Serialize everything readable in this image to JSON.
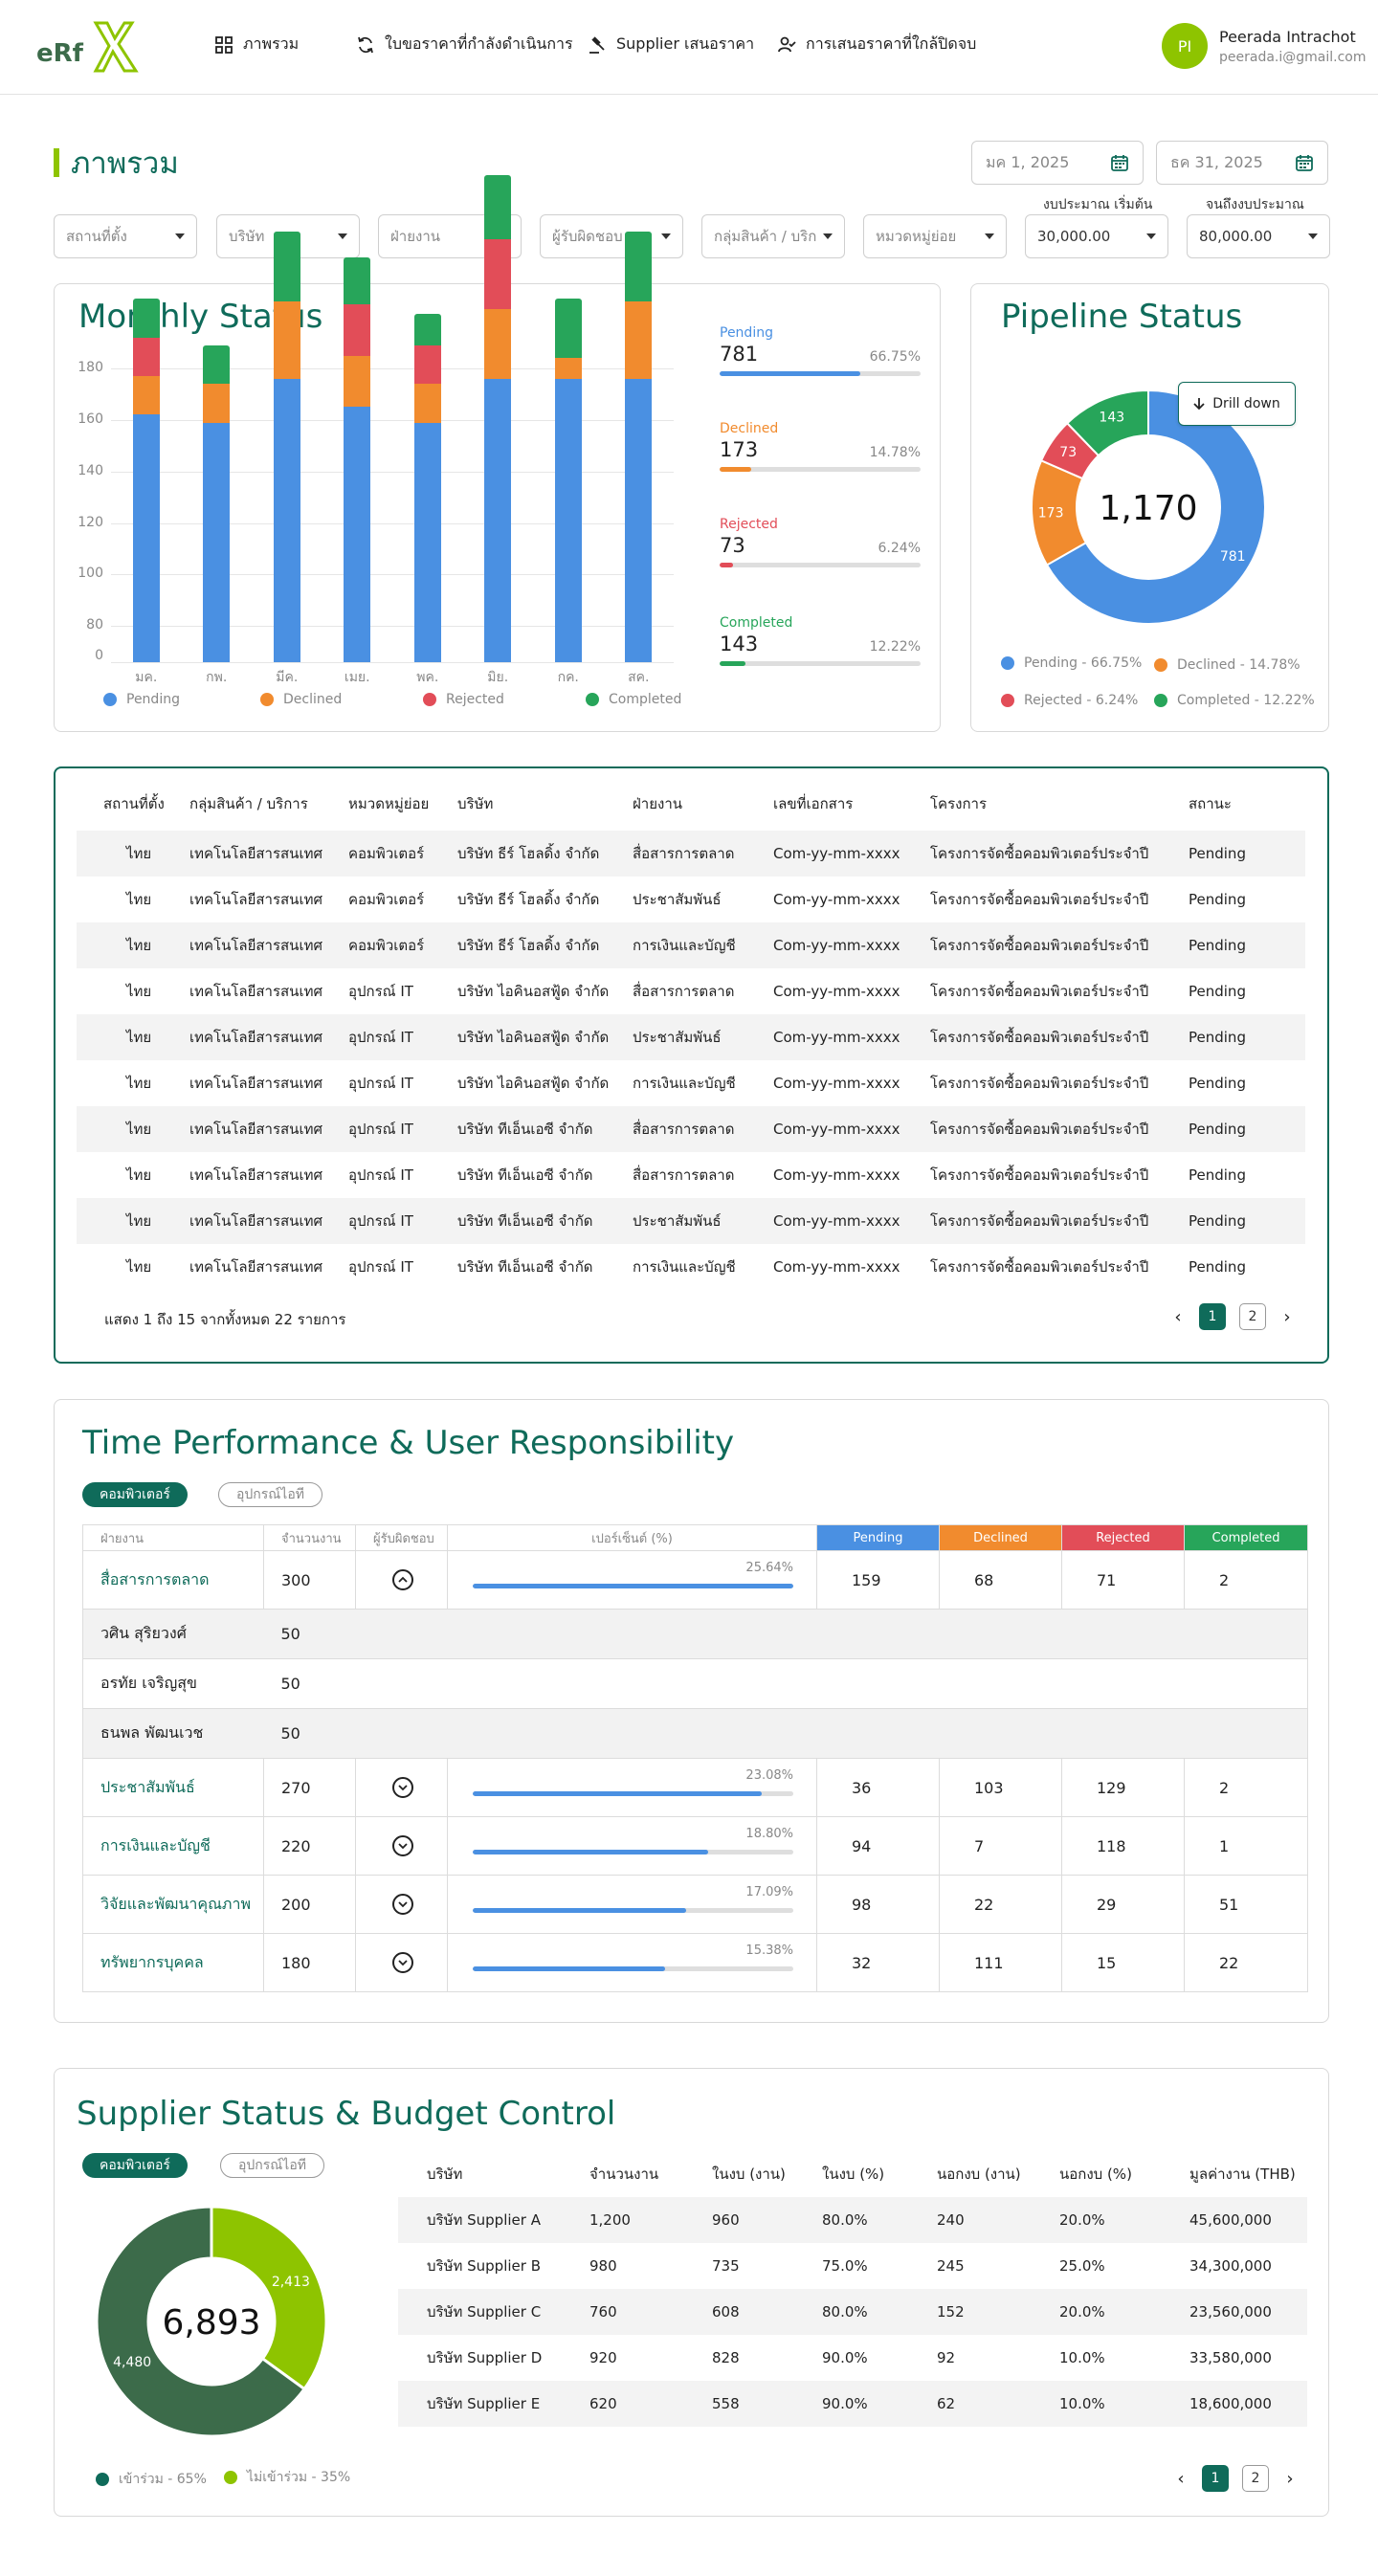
{
  "header": {
    "nav": [
      {
        "label": "ภาพรวม",
        "icon": "grid-icon"
      },
      {
        "label": "ใบขอราคาที่กำลังดำเนินการ",
        "icon": "refresh-icon"
      },
      {
        "label": "Supplier เสนอราคา",
        "icon": "gavel-icon"
      },
      {
        "label": "การเสนอราคาที่ใกล้ปิดจบ",
        "icon": "user-check-icon"
      }
    ],
    "user": {
      "initials": "PI",
      "name": "Peerada Intrachot",
      "email": "peerada.i@gmail.com"
    }
  },
  "page_title": "ภาพรวม",
  "dates": {
    "start": "มค 1, 2025",
    "end": "ธค 31, 2025"
  },
  "filters": [
    {
      "placeholder": "สถานที่ตั้ง"
    },
    {
      "placeholder": "บริษัท"
    },
    {
      "placeholder": "ฝ่ายงาน"
    },
    {
      "placeholder": "ผู้รับผิดชอบ"
    },
    {
      "placeholder": "กลุ่มสินค้า / บริการ"
    },
    {
      "placeholder": "หมวดหมู่ย่อย"
    }
  ],
  "budget": {
    "start_label": "งบประมาณ เริ่มต้น",
    "start_value": "30,000.00",
    "end_label": "จนถึงงบประมาณ",
    "end_value": "80,000.00"
  },
  "monthly": {
    "title": "Monthly Status",
    "stats": [
      {
        "label": "Pending",
        "value": "781",
        "pct": "66.75%",
        "fraction": 0.6675
      },
      {
        "label": "Declined",
        "value": "173",
        "pct": "14.78%",
        "fraction": 0.1478
      },
      {
        "label": "Rejected",
        "value": "73",
        "pct": "6.24%",
        "fraction": 0.0624
      },
      {
        "label": "Completed",
        "value": "143",
        "pct": "12.22%",
        "fraction": 0.1222
      }
    ]
  },
  "chart_data": [
    {
      "type": "bar",
      "stacked": true,
      "categories": [
        "มค.",
        "กพ.",
        "มีค.",
        "เมย.",
        "พค.",
        "มิย.",
        "กค.",
        "สค."
      ],
      "series": [
        {
          "name": "Pending",
          "color": "#4a90e2",
          "values": [
            96,
            93,
            110,
            99,
            93,
            110,
            110,
            110
          ]
        },
        {
          "name": "Declined",
          "color": "#f18b2e",
          "values": [
            15,
            15,
            30,
            20,
            15,
            27,
            8,
            30
          ]
        },
        {
          "name": "Rejected",
          "color": "#e24d58",
          "values": [
            15,
            0,
            0,
            20,
            15,
            27,
            0,
            0
          ]
        },
        {
          "name": "Completed",
          "color": "#27a55a",
          "values": [
            15,
            15,
            27,
            18,
            12,
            25,
            23,
            27
          ]
        }
      ],
      "yticks": [
        0,
        80,
        100,
        120,
        140,
        160,
        180
      ],
      "ylim": [
        66,
        180
      ],
      "grid": true,
      "legend": "bottom"
    },
    {
      "type": "pie",
      "title": "Pipeline Status",
      "donut": true,
      "center_label": "1,170",
      "labels": [
        "Pending",
        "Declined",
        "Rejected",
        "Completed"
      ],
      "values": [
        781,
        173,
        73,
        143
      ],
      "colors": [
        "#4a90e2",
        "#f18b2e",
        "#e24d58",
        "#27a55a"
      ],
      "legend": [
        "Pending - 66.75%",
        "Declined - 14.78%",
        "Rejected  - 6.24%",
        "Completed - 12.22%"
      ]
    },
    {
      "type": "pie",
      "donut": true,
      "center_label": "6,893",
      "labels": [
        "เข้าร่วม",
        "ไม่เข้าร่วม"
      ],
      "values": [
        4480,
        2413
      ],
      "value_labels": [
        "4,480",
        "2,413"
      ],
      "colors": [
        "#3c6b4a",
        "#8ec400"
      ],
      "legend": [
        "เข้าร่วม - 65%",
        "ไม่เข้าร่วม - 35%"
      ]
    }
  ],
  "pipeline": {
    "drill": "Drill down"
  },
  "main_table": {
    "columns": [
      "สถานที่ตั้ง",
      "กลุ่มสินค้า / บริการ",
      "หมวดหมู่ย่อย",
      "บริษัท",
      "ฝ่ายงาน",
      "เลขที่เอกสาร",
      "โครงการ",
      "สถานะ"
    ],
    "rows": [
      [
        "ไทย",
        "เทคโนโลยีสารสนเทศ",
        "คอมพิวเตอร์",
        "บริษัท ธีร์ โฮลดิ้ง จำกัด",
        "สื่อสารการตลาด",
        "Com-yy-mm-xxxx",
        "โครงการจัดซื้อคอมพิวเตอร์ประจำปี",
        "Pending"
      ],
      [
        "ไทย",
        "เทคโนโลยีสารสนเทศ",
        "คอมพิวเตอร์",
        "บริษัท ธีร์ โฮลดิ้ง จำกัด",
        "ประชาสัมพันธ์",
        "Com-yy-mm-xxxx",
        "โครงการจัดซื้อคอมพิวเตอร์ประจำปี",
        "Pending"
      ],
      [
        "ไทย",
        "เทคโนโลยีสารสนเทศ",
        "คอมพิวเตอร์",
        "บริษัท ธีร์ โฮลดิ้ง จำกัด",
        "การเงินและบัญชี",
        "Com-yy-mm-xxxx",
        "โครงการจัดซื้อคอมพิวเตอร์ประจำปี",
        "Pending"
      ],
      [
        "ไทย",
        "เทคโนโลยีสารสนเทศ",
        "อุปกรณ์ IT",
        "บริษัท ไอคินอสฟู้ด จำกัด",
        "สื่อสารการตลาด",
        "Com-yy-mm-xxxx",
        "โครงการจัดซื้อคอมพิวเตอร์ประจำปี",
        "Pending"
      ],
      [
        "ไทย",
        "เทคโนโลยีสารสนเทศ",
        "อุปกรณ์ IT",
        "บริษัท ไอคินอสฟู้ด จำกัด",
        "ประชาสัมพันธ์",
        "Com-yy-mm-xxxx",
        "โครงการจัดซื้อคอมพิวเตอร์ประจำปี",
        "Pending"
      ],
      [
        "ไทย",
        "เทคโนโลยีสารสนเทศ",
        "อุปกรณ์ IT",
        "บริษัท ไอคินอสฟู้ด จำกัด",
        "การเงินและบัญชี",
        "Com-yy-mm-xxxx",
        "โครงการจัดซื้อคอมพิวเตอร์ประจำปี",
        "Pending"
      ],
      [
        "ไทย",
        "เทคโนโลยีสารสนเทศ",
        "อุปกรณ์ IT",
        "บริษัท ทีเอ็นเอซี จำกัด",
        "สื่อสารการตลาด",
        "Com-yy-mm-xxxx",
        "โครงการจัดซื้อคอมพิวเตอร์ประจำปี",
        "Pending"
      ],
      [
        "ไทย",
        "เทคโนโลยีสารสนเทศ",
        "อุปกรณ์ IT",
        "บริษัท ทีเอ็นเอซี จำกัด",
        "สื่อสารการตลาด",
        "Com-yy-mm-xxxx",
        "โครงการจัดซื้อคอมพิวเตอร์ประจำปี",
        "Pending"
      ],
      [
        "ไทย",
        "เทคโนโลยีสารสนเทศ",
        "อุปกรณ์ IT",
        "บริษัท ทีเอ็นเอซี จำกัด",
        "ประชาสัมพันธ์",
        "Com-yy-mm-xxxx",
        "โครงการจัดซื้อคอมพิวเตอร์ประจำปี",
        "Pending"
      ],
      [
        "ไทย",
        "เทคโนโลยีสารสนเทศ",
        "อุปกรณ์ IT",
        "บริษัท ทีเอ็นเอซี จำกัด",
        "การเงินและบัญชี",
        "Com-yy-mm-xxxx",
        "โครงการจัดซื้อคอมพิวเตอร์ประจำปี",
        "Pending"
      ]
    ],
    "summary": "แสดง 1 ถึง 15 จากทั้งหมด 22 รายการ",
    "pages": [
      "1",
      "2"
    ],
    "current_page": "1"
  },
  "time_perf": {
    "title": "Time Performance & User Responsibility",
    "tabs": [
      "คอมพิวเตอร์",
      "อุปกรณ์ไอที"
    ],
    "columns": [
      "ฝ่ายงาน",
      "จำนวนงาน",
      "ผู้รับผิดชอบ",
      "เปอร์เซ็นต์ (%)",
      "Pending",
      "Declined",
      "Rejected",
      "Completed"
    ],
    "rows": [
      {
        "dept": "สื่อสารการตลาด",
        "count": "300",
        "expanded": true,
        "pct": "25.64%",
        "fraction": 0.2564,
        "pending": "159",
        "declined": "68",
        "rejected": "71",
        "completed": "2",
        "users": [
          {
            "name": "วศิน สุริยวงศ์",
            "count": "50"
          },
          {
            "name": "อรทัย เจริญสุข",
            "count": "50"
          },
          {
            "name": "ธนพล พัฒนเวช",
            "count": "50"
          }
        ]
      },
      {
        "dept": "ประชาสัมพันธ์",
        "count": "270",
        "expanded": false,
        "pct": "23.08%",
        "fraction": 0.2308,
        "pending": "36",
        "declined": "103",
        "rejected": "129",
        "completed": "2"
      },
      {
        "dept": "การเงินและบัญชี",
        "count": "220",
        "expanded": false,
        "pct": "18.80%",
        "fraction": 0.188,
        "pending": "94",
        "declined": "7",
        "rejected": "118",
        "completed": "1"
      },
      {
        "dept": "วิจัยและพัฒนาคุณภาพ",
        "count": "200",
        "expanded": false,
        "pct": "17.09%",
        "fraction": 0.1709,
        "pending": "98",
        "declined": "22",
        "rejected": "29",
        "completed": "51"
      },
      {
        "dept": "ทรัพยากรบุคคล",
        "count": "180",
        "expanded": false,
        "pct": "15.38%",
        "fraction": 0.1538,
        "pending": "32",
        "declined": "111",
        "rejected": "15",
        "completed": "22"
      }
    ]
  },
  "supplier": {
    "title": "Supplier Status & Budget Control",
    "tabs": [
      "คอมพิวเตอร์",
      "อุปกรณ์ไอที"
    ],
    "columns": [
      "บริษัท",
      "จำนวนงาน",
      "ในงบ (งาน)",
      "ในงบ (%)",
      "นอกงบ (งาน)",
      "นอกงบ (%)",
      "มูลค่างาน (THB)"
    ],
    "rows": [
      [
        "บริษัท Supplier A",
        "1,200",
        "960",
        "80.0%",
        "240",
        "20.0%",
        "45,600,000"
      ],
      [
        "บริษัท Supplier B",
        "980",
        "735",
        "75.0%",
        "245",
        "25.0%",
        "34,300,000"
      ],
      [
        "บริษัท Supplier C",
        "760",
        "608",
        "80.0%",
        "152",
        "20.0%",
        "23,560,000"
      ],
      [
        "บริษัท Supplier D",
        "920",
        "828",
        "90.0%",
        "92",
        "10.0%",
        "33,580,000"
      ],
      [
        "บริษัท Supplier E",
        "620",
        "558",
        "90.0%",
        "62",
        "10.0%",
        "18,600,000"
      ]
    ],
    "pages": [
      "1",
      "2"
    ],
    "current_page": "1"
  },
  "colors": {
    "brand": "#0f6b5a",
    "accent": "#8ec400",
    "pending": "#4a90e2",
    "declined": "#f18b2e",
    "rejected": "#e24d58",
    "completed": "#27a55a"
  }
}
